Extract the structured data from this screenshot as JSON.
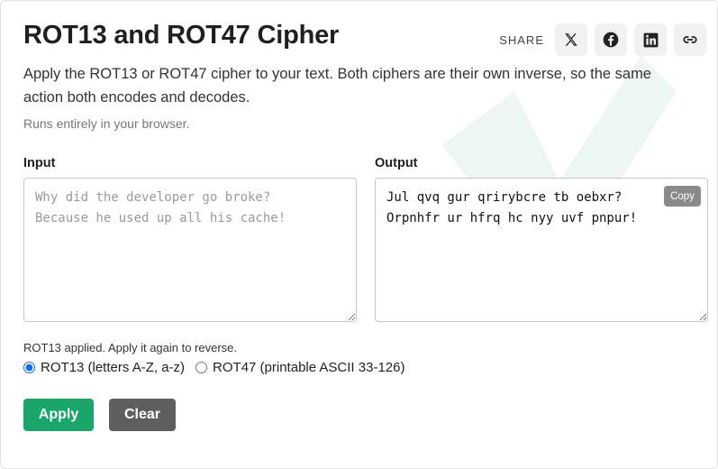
{
  "page": {
    "title": "ROT13 and ROT47 Cipher",
    "description": "Apply the ROT13 or ROT47 cipher to your text. Both ciphers are their own inverse, so the same action both encodes and decodes.",
    "note": "Runs entirely in your browser."
  },
  "share": {
    "label": "SHARE",
    "buttons": [
      {
        "icon": "x-twitter-icon"
      },
      {
        "icon": "facebook-icon"
      },
      {
        "icon": "linkedin-icon"
      },
      {
        "icon": "link-icon"
      }
    ]
  },
  "input": {
    "label": "Input",
    "value": "",
    "placeholder": "Why did the developer go broke?\nBecause he used up all his cache!"
  },
  "output": {
    "label": "Output",
    "value": "Jul qvq gur qrirybcre tb oebxr?\nOrpnhfr ur hfrq hc nyy uvf pnpur!",
    "copy_label": "Copy"
  },
  "status": "ROT13 applied. Apply it again to reverse.",
  "modes": {
    "selected": "rot13",
    "options": [
      {
        "id": "rot13",
        "label": "ROT13 (letters A-Z, a-z)"
      },
      {
        "id": "rot47",
        "label": "ROT47 (printable ASCII 33-126)"
      }
    ]
  },
  "actions": {
    "apply_label": "Apply",
    "clear_label": "Clear"
  },
  "colors": {
    "apply": "#1aa56b",
    "clear": "#5e5e5e",
    "copy": "#8a8a8a",
    "share_bg": "#f1f1f1"
  }
}
